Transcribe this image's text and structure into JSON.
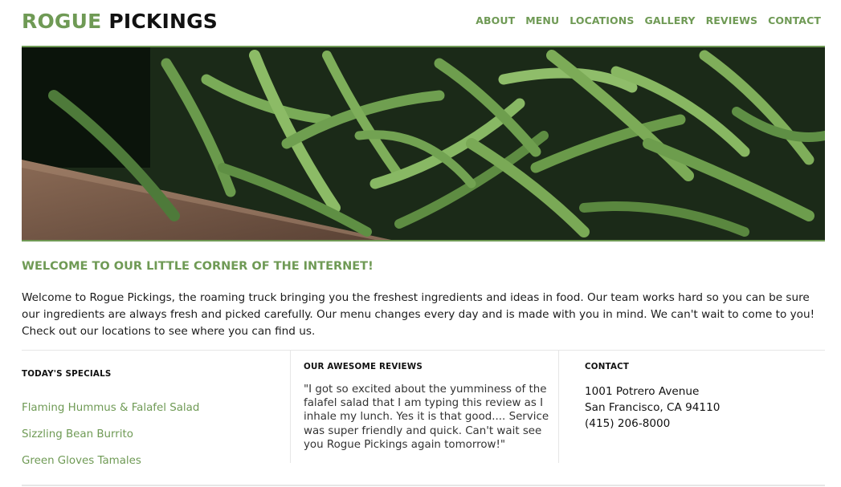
{
  "header": {
    "logo_accent": "ROGUE",
    "logo_main": "PICKINGS",
    "nav": [
      "ABOUT",
      "MENU",
      "LOCATIONS",
      "GALLERY",
      "REVIEWS",
      "CONTACT"
    ]
  },
  "hero": {
    "image": "green-beans-photo"
  },
  "welcome": {
    "title": "WELCOME TO OUR LITTLE CORNER OF THE INTERNET!",
    "body": "Welcome to Rogue Pickings, the roaming truck bringing you the freshest ingredients and ideas in food. Our team works hard so you can be sure our ingredients are always fresh and picked carefully. Our menu changes every day and is made with you in mind. We can't wait to come to you! Check out our locations to see where you can find us."
  },
  "specials": {
    "heading": "TODAY'S SPECIALS",
    "items": [
      "Flaming Hummus & Falafel Salad",
      "Sizzling Bean Burrito",
      "Green Gloves Tamales"
    ]
  },
  "reviews": {
    "heading": "OUR AWESOME REVIEWS",
    "text": "\"I got so excited about the yumminess of the falafel salad that I am typing this review as I inhale my lunch. Yes it is that good.... Service was super friendly and quick. Can't wait see you Rogue Pickings again tomorrow!\""
  },
  "contact": {
    "heading": "CONTACT",
    "address1": "1001 Potrero Avenue",
    "address2": "San Francisco, CA 94110",
    "phone": "(415) 206-8000"
  },
  "colors": {
    "accent": "#6f9a55",
    "text": "#111111",
    "divider": "#e6e6e6"
  }
}
